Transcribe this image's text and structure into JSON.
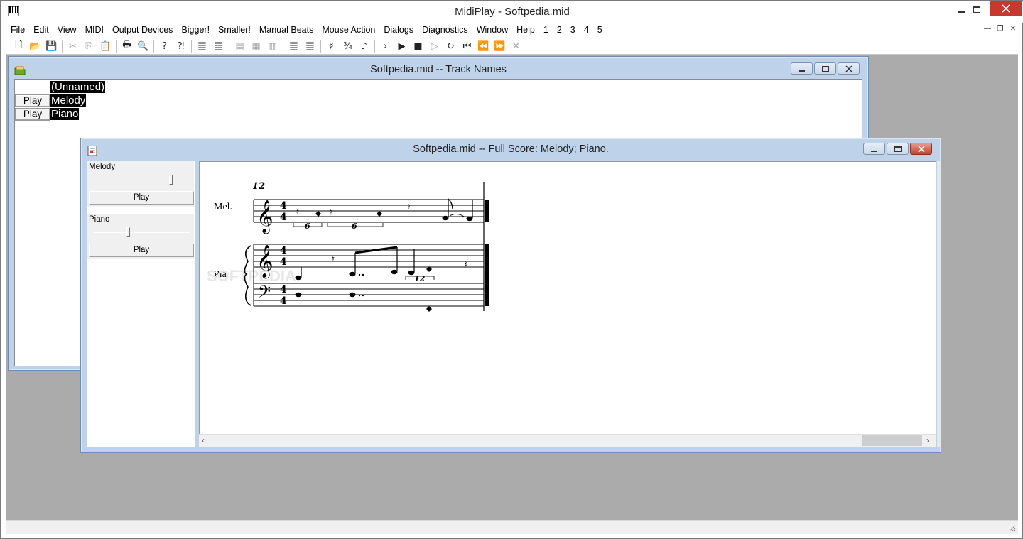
{
  "window": {
    "title": "MidiPlay - Softpedia.mid"
  },
  "menu": [
    "File",
    "Edit",
    "View",
    "MIDI",
    "Output Devices",
    "Bigger!",
    "Smaller!",
    "Manual Beats",
    "Mouse Action",
    "Dialogs",
    "Diagnostics",
    "Window",
    "Help",
    "1",
    "2",
    "3",
    "4",
    "5"
  ],
  "toolbar": {
    "icons": [
      "new-file-icon",
      "open-folder-icon",
      "save-icon",
      "cut-icon",
      "copy-icon",
      "paste-icon",
      "print-icon",
      "print-preview-icon",
      "help-icon",
      "context-help-icon",
      "score-view-icon",
      "score-edit-icon",
      "track-view-icon",
      "track-edit-icon",
      "staff-icon",
      "measures-icon",
      "measures-edit-icon",
      "sharp-icon",
      "time-signature-icon",
      "metronome-icon",
      "play-forward-icon",
      "play-icon",
      "stop-icon",
      "pause-icon",
      "loop-icon",
      "to-start-icon",
      "rewind-icon",
      "fast-forward-icon",
      "cancel-icon"
    ]
  },
  "track_window": {
    "title": "Softpedia.mid -- Track Names",
    "header_name": "(Unnamed)",
    "rows": [
      {
        "button": "Play",
        "name": "Melody"
      },
      {
        "button": "Play",
        "name": "Piano"
      }
    ]
  },
  "score_window": {
    "title": "Softpedia.mid -- Full Score: Melody; Piano.",
    "channels": [
      {
        "label": "Melody",
        "slider_level": 0.82,
        "button": "Play"
      },
      {
        "label": "Piano",
        "slider_level": 0.36,
        "button": "Play"
      }
    ],
    "score": {
      "measure_number": "12",
      "staff_labels": [
        "Mel.",
        "Pia."
      ],
      "time_signature": [
        "4",
        "4"
      ],
      "tuplets": [
        "6",
        "6",
        "12"
      ],
      "watermark": "SOFTPEDIA"
    }
  },
  "colors": {
    "mdi_background": "#ababab",
    "child_frame": "#bed3ea",
    "close_button": "#c7392f"
  }
}
